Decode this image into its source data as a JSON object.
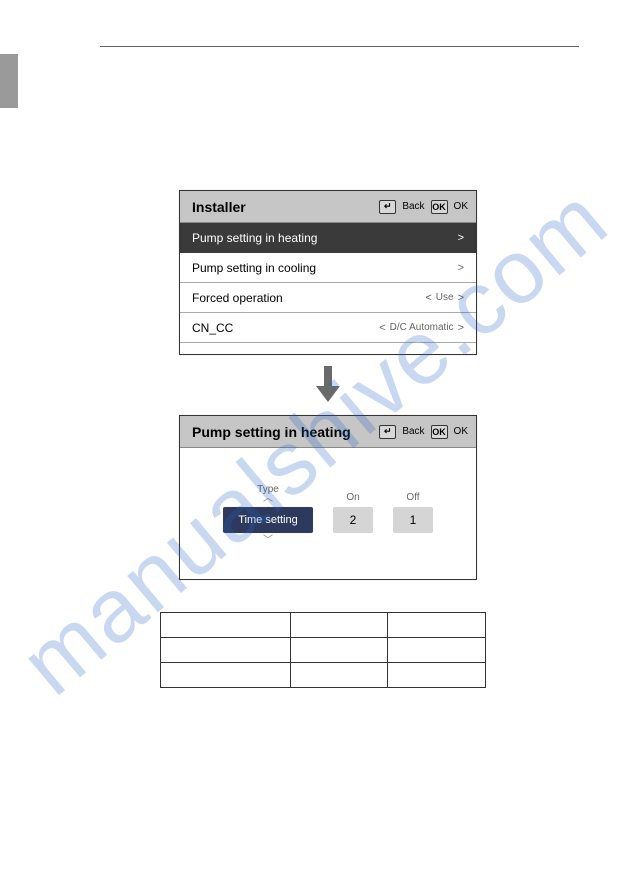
{
  "watermark": "manualshive.com",
  "header_actions": {
    "back_label": "Back",
    "ok_label": "OK",
    "back_icon_glyph": "↵",
    "ok_icon_glyph": "OK"
  },
  "panel1": {
    "title": "Installer",
    "rows": [
      {
        "label": "Pump setting in heating",
        "left_chev": "",
        "value": "",
        "right_chev": ">",
        "selected": true
      },
      {
        "label": "Pump setting in cooling",
        "left_chev": "",
        "value": "",
        "right_chev": ">",
        "selected": false
      },
      {
        "label": "Forced operation",
        "left_chev": "<",
        "value": "Use",
        "right_chev": ">",
        "selected": false
      },
      {
        "label": "CN_CC",
        "left_chev": "<",
        "value": "D/C Automatic",
        "right_chev": ">",
        "selected": false
      }
    ]
  },
  "panel2": {
    "title": "Pump setting in heating",
    "columns": {
      "type": "Type",
      "on": "On",
      "off": "Off"
    },
    "type_value": "Time setting",
    "on_value": "2",
    "off_value": "1"
  }
}
